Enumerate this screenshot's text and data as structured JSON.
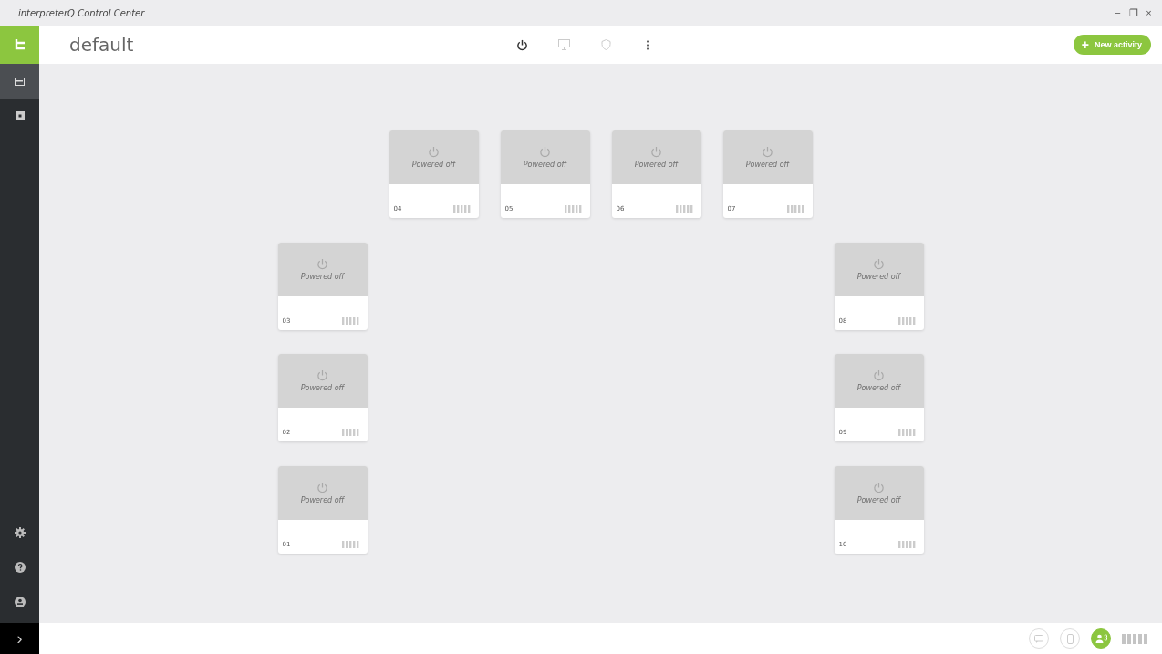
{
  "window": {
    "title": "interpreterQ Control Center",
    "controls": [
      "−",
      "❐",
      "×"
    ]
  },
  "sidebar": {
    "items": [
      {
        "kind": "screen",
        "selected": true
      },
      {
        "kind": "square",
        "selected": false
      }
    ],
    "bottom_items": [
      {
        "kind": "gear"
      },
      {
        "kind": "help"
      },
      {
        "kind": "user"
      }
    ],
    "expand": "›"
  },
  "header": {
    "title": "default",
    "tools": [
      {
        "kind": "power",
        "disabled": false
      },
      {
        "kind": "monitor",
        "disabled": true
      },
      {
        "kind": "shield",
        "disabled": true
      },
      {
        "kind": "more",
        "disabled": false
      }
    ],
    "new_button": {
      "icon": "+",
      "label": "New activity"
    }
  },
  "booths": [
    {
      "number": "04",
      "powered": false,
      "status": "Powered off"
    },
    {
      "number": "05",
      "powered": false,
      "status": "Powered off"
    },
    {
      "number": "06",
      "powered": false,
      "status": "Powered off"
    },
    {
      "number": "07",
      "powered": false,
      "status": "Powered off"
    },
    {
      "number": "03",
      "powered": false,
      "status": "Powered off"
    },
    {
      "number": "08",
      "powered": false,
      "status": "Powered off"
    },
    {
      "number": "02",
      "powered": false,
      "status": "Powered off"
    },
    {
      "number": "09",
      "powered": false,
      "status": "Powered off"
    },
    {
      "number": "01",
      "powered": false,
      "status": "Powered off"
    },
    {
      "number": "10",
      "powered": false,
      "status": "Powered off"
    }
  ],
  "status_bar": {
    "buttons": [
      {
        "kind": "chat",
        "selected": false
      },
      {
        "kind": "phone",
        "selected": false
      },
      {
        "kind": "speaker",
        "selected": true
      }
    ]
  }
}
